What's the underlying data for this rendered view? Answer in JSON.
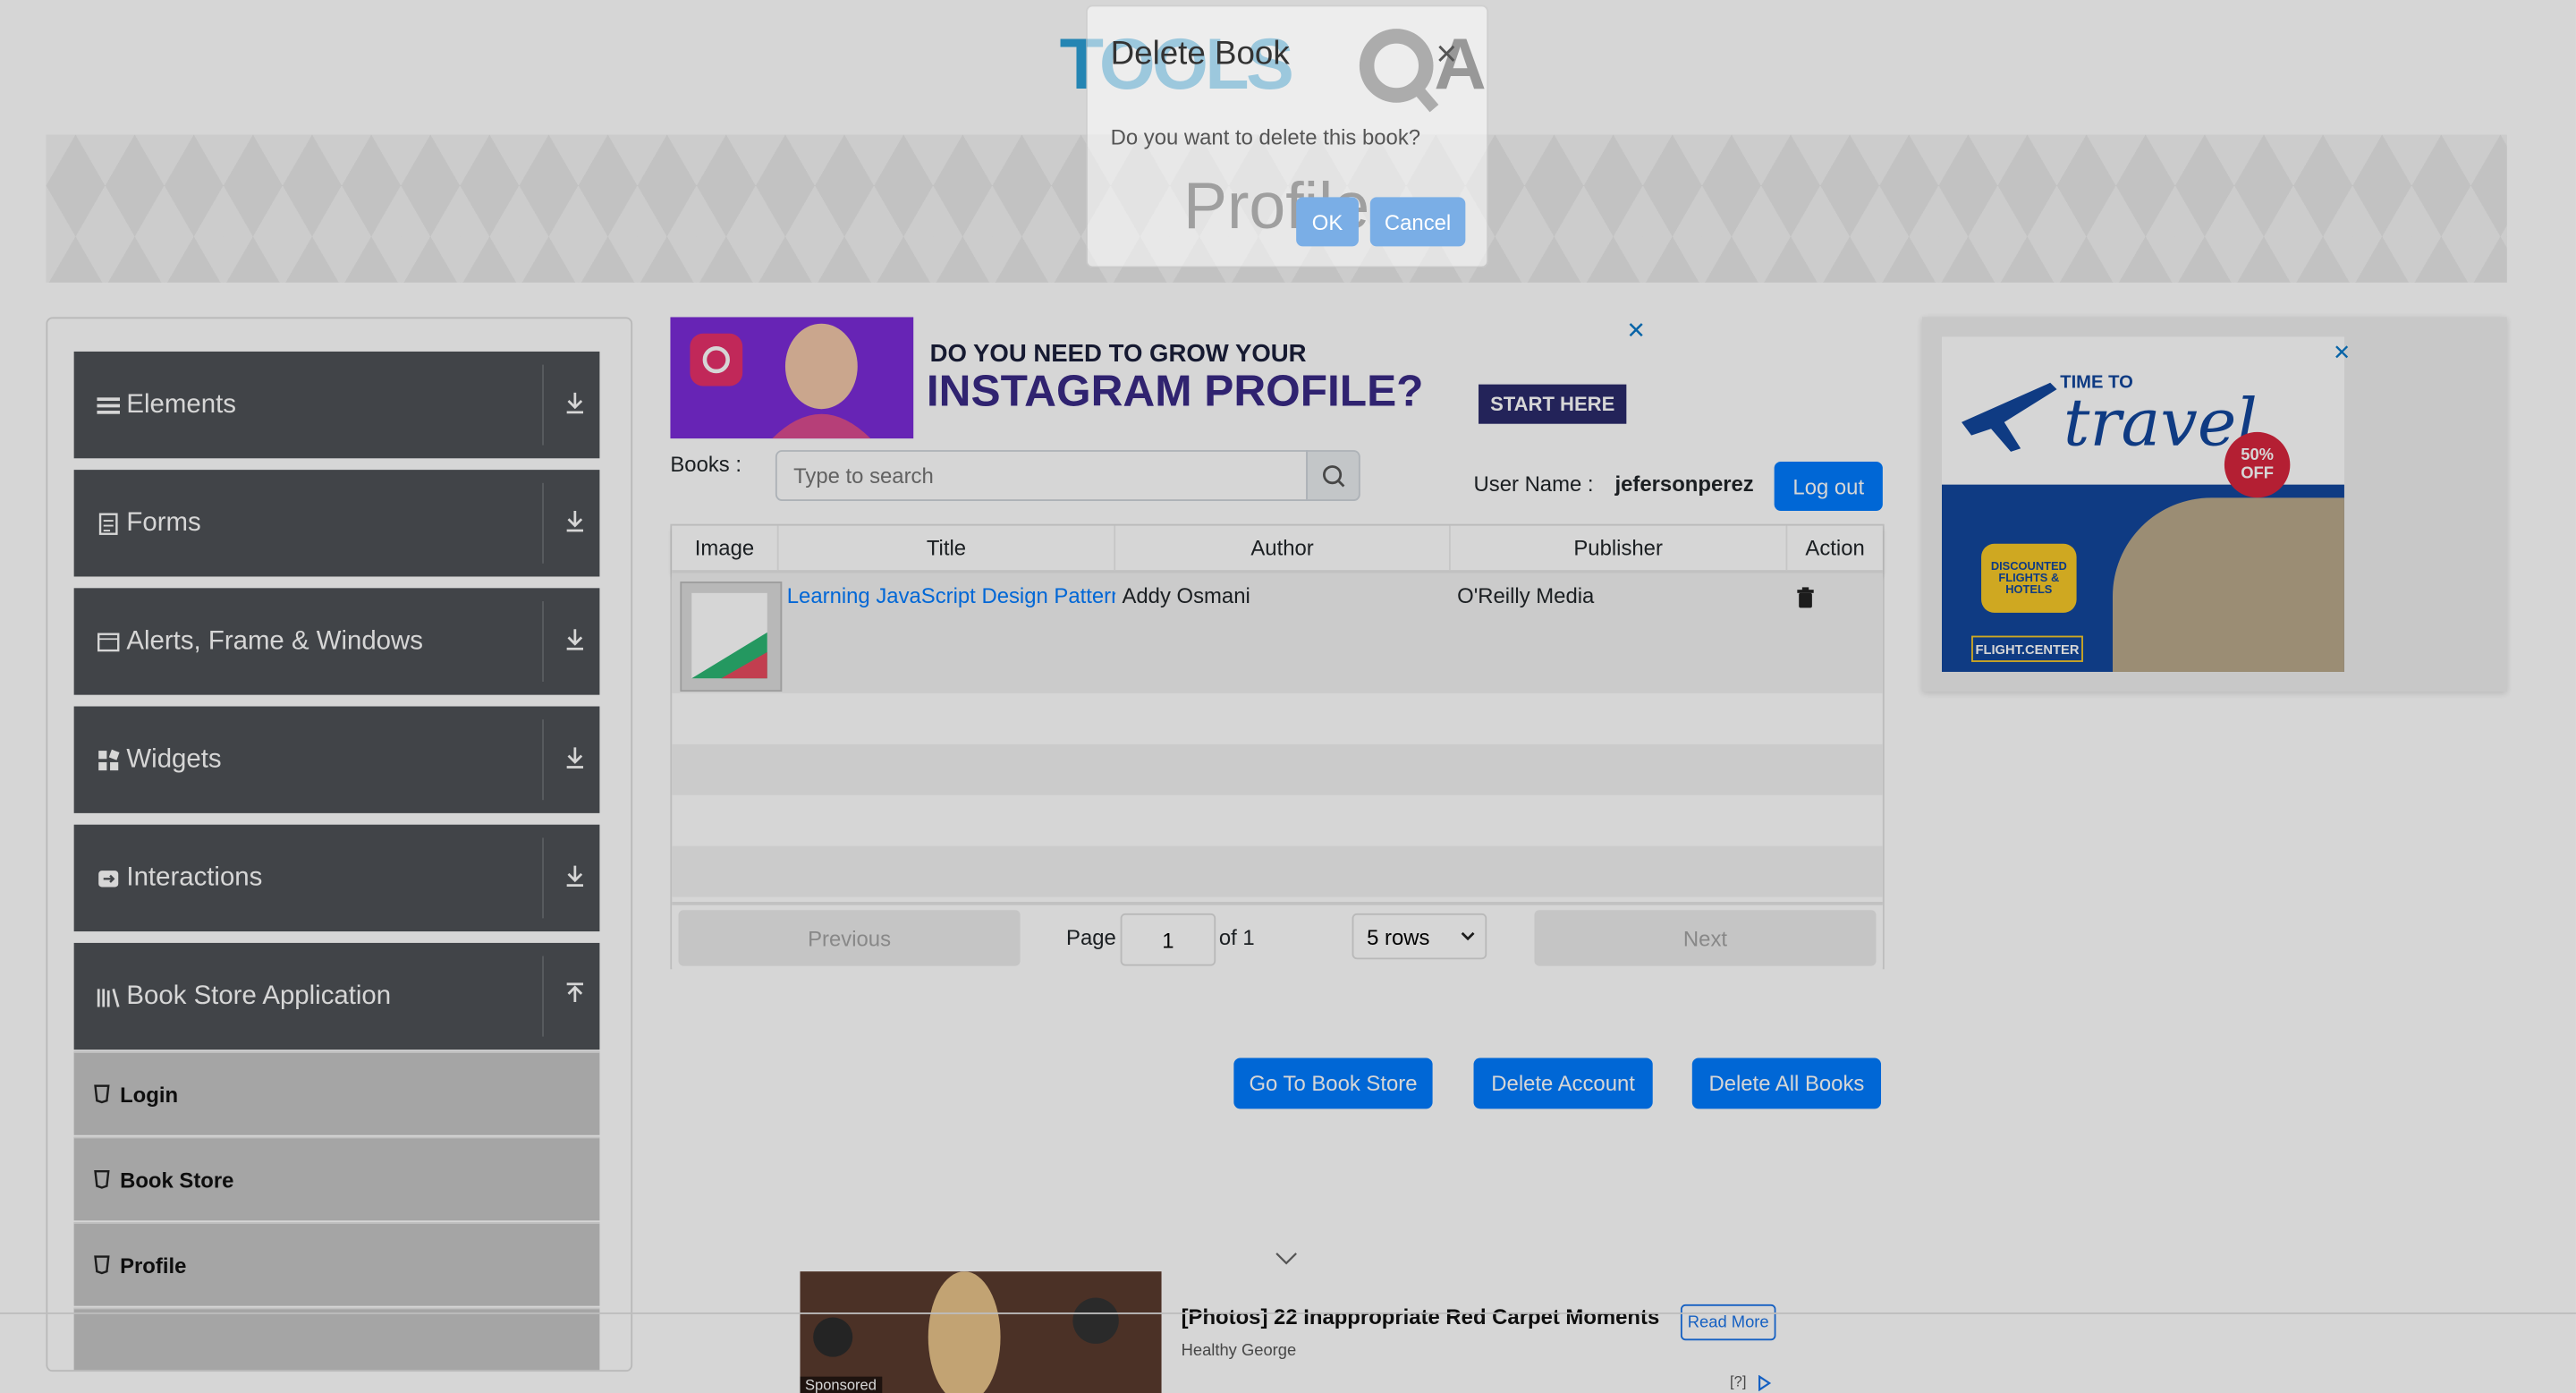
{
  "colors": {
    "primary": "#007bff",
    "sidebar_group": "#4e5256",
    "sidebar_sub": "#c5c5c5"
  },
  "banner": {
    "title": "Profile"
  },
  "sidebar": {
    "groups": [
      {
        "label": "Elements",
        "icon": "menu-icon"
      },
      {
        "label": "Forms",
        "icon": "form-icon"
      },
      {
        "label": "Alerts, Frame & Windows",
        "icon": "window-icon"
      },
      {
        "label": "Widgets",
        "icon": "widgets-icon"
      },
      {
        "label": "Interactions",
        "icon": "interactions-icon"
      },
      {
        "label": "Book Store Application",
        "icon": "books-icon"
      }
    ],
    "items": [
      {
        "label": "Login"
      },
      {
        "label": "Book Store"
      },
      {
        "label": "Profile"
      }
    ]
  },
  "top_ad": {
    "line1": "DO YOU NEED TO GROW YOUR",
    "line2": "INSTAGRAM PROFILE?",
    "cta": "START HERE",
    "close": "✕"
  },
  "books": {
    "label": "Books :",
    "search_placeholder": "Type to search",
    "user_label": "User Name :",
    "user_name": "jefersonperez",
    "logout": "Log out",
    "columns": [
      "Image",
      "Title",
      "Author",
      "Publisher",
      "Action"
    ],
    "rows": [
      {
        "title": "Learning JavaScript Design Patterns",
        "author": "Addy Osmani",
        "publisher": "O'Reilly Media"
      }
    ],
    "pagination": {
      "previous": "Previous",
      "page": "Page",
      "current": "1",
      "of": "of 1",
      "rows": "5 rows",
      "next": "Next"
    }
  },
  "actions": {
    "go_store": "Go To Book Store",
    "delete_account": "Delete Account",
    "delete_all": "Delete All Books"
  },
  "right_ad": {
    "t1": "TIME TO",
    "t2": "travel",
    "badge": "50% OFF",
    "yellow": "DISCOUNTED FLIGHTS & HOTELS",
    "brand": "FLIGHT.CENTER",
    "close": "✕"
  },
  "bottom_ad": {
    "headline": "[Photos] 22 Inappropriate Red Carpet Moments",
    "source": "Healthy George",
    "read_more": "Read More",
    "sponsored": "Sponsored",
    "info": "[?]"
  },
  "modal": {
    "title": "Delete Book",
    "close": "×",
    "body": "Do you want to delete this book?",
    "ok": "OK",
    "cancel": "Cancel"
  }
}
